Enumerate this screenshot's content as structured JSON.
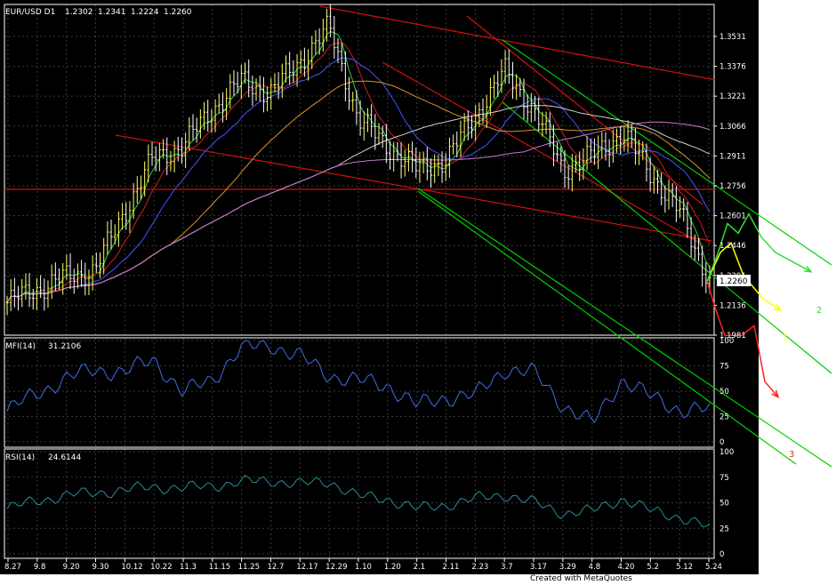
{
  "header": {
    "symbol": "EUR/USD D1",
    "open": "1.2302",
    "high": "1.2341",
    "low": "1.2224",
    "close": "1.2260"
  },
  "footer": "Created with MetaQuotes",
  "colors": {
    "background": "#000000",
    "grid": "#3a3a3a",
    "up_bar": "#ffff66",
    "down_bar": "#ffffff",
    "mfi": "#3d6fe0",
    "rsi": "#2a8c96",
    "channel": "#00d000",
    "trend": "#d01010",
    "ma_red": "#cc1f1f",
    "ma_green": "#33cc33",
    "ma_blue": "#4455ff",
    "ma_orange": "#e0932a",
    "ma_white": "#cfcfcf",
    "ma_violet": "#c878c8"
  },
  "chart_data": [
    {
      "type": "line",
      "title": "EUR/USD D1",
      "x": [
        "8.27",
        "9.8",
        "9.20",
        "9.30",
        "10.12",
        "10.22",
        "11.3",
        "11.15",
        "11.25",
        "12.7",
        "12.17",
        "12.29",
        "1.10",
        "1.20",
        "2.1",
        "2.11",
        "2.23",
        "3.7",
        "3.17",
        "3.29",
        "4.8",
        "4.20",
        "5.2",
        "5.12",
        "5.24"
      ],
      "y_ticks": [
        "1.3531",
        "1.3376",
        "1.3221",
        "1.3066",
        "1.2911",
        "1.2756",
        "1.2601",
        "1.2446",
        "1.2291",
        "1.2136",
        "1.1981"
      ],
      "ylim": [
        1.1981,
        1.366
      ],
      "current_price_label": "1.2260",
      "series": [
        {
          "values": [
            1.215,
            1.222,
            1.228,
            1.232,
            1.262,
            1.29,
            1.296,
            1.315,
            1.33,
            1.324,
            1.34,
            1.358,
            1.31,
            1.296,
            1.284,
            1.289,
            1.312,
            1.335,
            1.315,
            1.284,
            1.291,
            1.303,
            1.282,
            1.261,
            1.226
          ]
        }
      ],
      "projection_labels": [
        "1",
        "2",
        "3"
      ],
      "projection": [
        {
          "name": "1",
          "color": "#ffff00",
          "values": [
            1.226,
            1.241,
            1.246,
            1.229,
            1.217,
            1.211
          ]
        },
        {
          "name": "2",
          "color": "#33dd33",
          "values": [
            1.226,
            1.239,
            1.256,
            1.251,
            1.261,
            1.249,
            1.241,
            1.231
          ]
        },
        {
          "name": "3",
          "color": "#ff2020",
          "values": [
            1.226,
            1.211,
            1.198,
            1.198,
            1.203,
            1.174,
            1.166
          ]
        }
      ]
    },
    {
      "type": "line",
      "title": "MFI(14)",
      "value": "31.2106",
      "x": [
        "8.27",
        "9.8",
        "9.20",
        "9.30",
        "10.12",
        "10.22",
        "11.3",
        "11.15",
        "11.25",
        "12.7",
        "12.17",
        "12.29",
        "1.10",
        "1.20",
        "2.1",
        "2.11",
        "2.23",
        "3.7",
        "3.17",
        "3.29",
        "4.8",
        "4.20",
        "5.2",
        "5.12",
        "5.24"
      ],
      "y_ticks": [
        "100",
        "75",
        "50",
        "25",
        "0"
      ],
      "ylim": [
        0,
        100
      ],
      "series": [
        {
          "values": [
            30,
            48,
            62,
            72,
            68,
            82,
            48,
            62,
            92,
            96,
            84,
            66,
            60,
            56,
            36,
            44,
            46,
            72,
            68,
            36,
            18,
            62,
            44,
            32,
            31
          ]
        }
      ]
    },
    {
      "type": "line",
      "title": "RSI(14)",
      "value": "24.6144",
      "x": [
        "8.27",
        "9.8",
        "9.20",
        "9.30",
        "10.12",
        "10.22",
        "11.3",
        "11.15",
        "11.25",
        "12.7",
        "12.17",
        "12.29",
        "1.10",
        "1.20",
        "2.1",
        "2.11",
        "2.23",
        "3.7",
        "3.17",
        "3.29",
        "4.8",
        "4.20",
        "5.2",
        "5.12",
        "5.24"
      ],
      "y_ticks": [
        "100",
        "75",
        "50",
        "25",
        "0"
      ],
      "ylim": [
        0,
        100
      ],
      "series": [
        {
          "values": [
            44,
            52,
            57,
            60,
            62,
            66,
            64,
            67,
            70,
            72,
            68,
            71,
            56,
            54,
            44,
            48,
            54,
            58,
            50,
            40,
            42,
            54,
            42,
            36,
            25
          ]
        }
      ]
    }
  ]
}
